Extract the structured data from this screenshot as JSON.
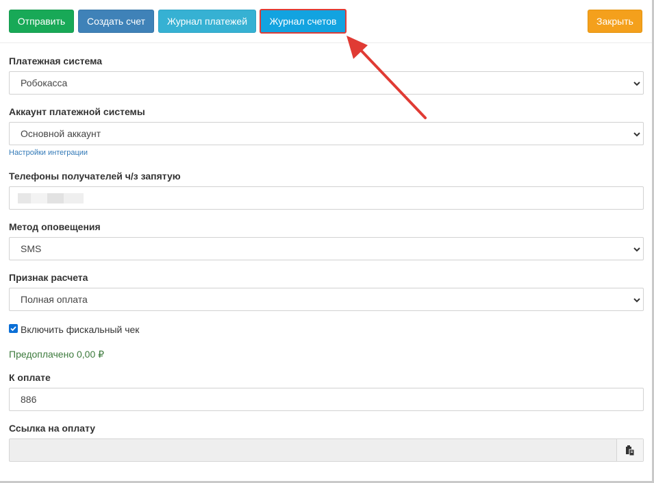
{
  "toolbar": {
    "send_label": "Отправить",
    "create_invoice_label": "Создать счет",
    "payments_log_label": "Журнал платежей",
    "invoices_log_label": "Журнал счетов",
    "close_label": "Закрыть"
  },
  "form": {
    "payment_system": {
      "label": "Платежная система",
      "value": "Робокасса"
    },
    "account": {
      "label": "Аккаунт платежной системы",
      "value": "Основной аккаунт",
      "settings_link": "Настройки интеграции"
    },
    "phones": {
      "label": "Телефоны получателей ч/з запятую",
      "value": ""
    },
    "notify_method": {
      "label": "Метод оповещения",
      "value": "SMS"
    },
    "payment_sign": {
      "label": "Признак расчета",
      "value": "Полная оплата"
    },
    "fiscal_check": {
      "label": "Включить фискальный чек",
      "checked": true
    },
    "prepaid_text": "Предоплачено 0,00 ₽",
    "amount": {
      "label": "К оплате",
      "value": "886"
    },
    "pay_link": {
      "label": "Ссылка на оплату",
      "value": ""
    }
  },
  "colors": {
    "send": "#18a957",
    "create_invoice": "#3f82b8",
    "payments_log": "#36b1d3",
    "invoices_log": "#12a3e0",
    "close": "#f4a01c",
    "annotation_arrow": "#e03b34"
  },
  "icons": {
    "select_chevron": "chevron-down-icon",
    "copy": "clipboard-icon",
    "checkbox": "check-icon"
  }
}
